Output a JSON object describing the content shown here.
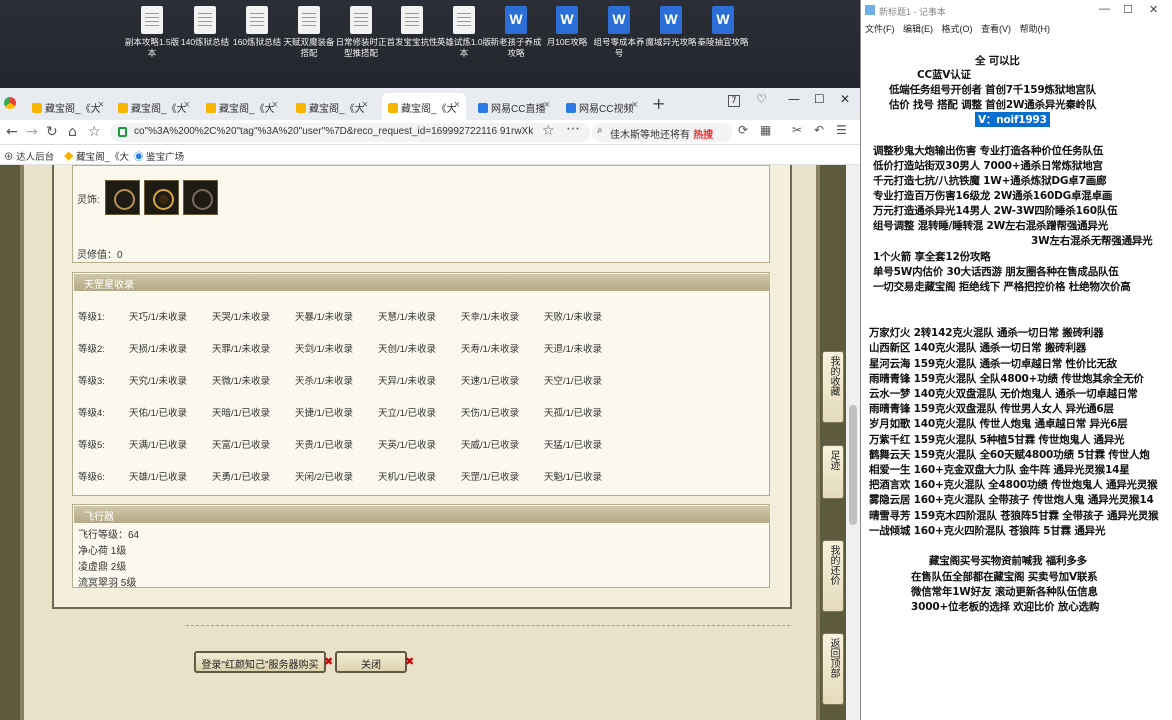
{
  "desktop": {
    "icons": [
      {
        "label": "副本攻略1.5版本",
        "type": "doc"
      },
      {
        "label": "140炼狱总结",
        "type": "doc"
      },
      {
        "label": "160炼狱总结",
        "type": "doc"
      },
      {
        "label": "天赋双魔装备搭配",
        "type": "doc"
      },
      {
        "label": "日常修装时正型推搭配",
        "type": "doc"
      },
      {
        "label": "首发宝宝抗性",
        "type": "doc"
      },
      {
        "label": "英雄试炼1.0版本",
        "type": "doc"
      },
      {
        "label": "新老孩子养成攻略",
        "type": "word"
      },
      {
        "label": "月10E攻略",
        "type": "word"
      },
      {
        "label": "组号零成本养号",
        "type": "word"
      },
      {
        "label": "魔域异光攻略",
        "type": "word"
      },
      {
        "label": "秦陵抽宜攻略",
        "type": "word"
      }
    ]
  },
  "browser": {
    "tabs": [
      {
        "label": "藏宝阁_《大",
        "icon": "treasure-icon"
      },
      {
        "label": "藏宝阁_《大",
        "icon": "treasure-icon"
      },
      {
        "label": "藏宝阁_《大",
        "icon": "treasure-icon"
      },
      {
        "label": "藏宝阁_《大",
        "icon": "treasure-icon"
      },
      {
        "label": "藏宝阁_《大",
        "icon": "treasure-icon"
      },
      {
        "label": "网易CC直播",
        "icon": "cc-icon"
      },
      {
        "label": "网易CC视频",
        "icon": "cc-icon"
      }
    ],
    "tab_badge": "7",
    "url": "co\"%3A%200%2C%20\"tag\"%3A%20\"user\"%7D&reco_request_id=169992722116 91rwXk",
    "search_placeholder": "佳木斯等地还将有",
    "search_hot": "热搜",
    "bookmarks": [
      "达人后台",
      "藏宝阁_《大",
      "鉴宝广场"
    ]
  },
  "page": {
    "gems_label": "灵饰:",
    "spirit_value_label": "灵修值：",
    "spirit_value": "0",
    "stars_header": "天罡星收录",
    "star_rows": [
      {
        "level": "等级1:",
        "items": [
          "天巧/1/未收录",
          "天哭/1/未收录",
          "天暴/1/未收录",
          "天慧/1/未收录",
          "天幸/1/未收录",
          "天败/1/未收录"
        ]
      },
      {
        "level": "等级2:",
        "items": [
          "天损/1/未收录",
          "天罪/1/未收录",
          "天剑/1/未收录",
          "天创/1/未收录",
          "天寿/1/未收录",
          "天退/1/未收录"
        ]
      },
      {
        "level": "等级3:",
        "items": [
          "天究/1/未收录",
          "天微/1/未收录",
          "天杀/1/未收录",
          "天异/1/未收录",
          "天速/1/已收录",
          "天空/1/已收录"
        ]
      },
      {
        "level": "等级4:",
        "items": [
          "天佑/1/已收录",
          "天暗/1/已收录",
          "天捷/1/已收录",
          "天立/1/已收录",
          "天伤/1/已收录",
          "天孤/1/已收录"
        ]
      },
      {
        "level": "等级5:",
        "items": [
          "天满/1/已收录",
          "天富/1/已收录",
          "天贵/1/已收录",
          "天英/1/已收录",
          "天威/1/已收录",
          "天猛/1/已收录"
        ]
      },
      {
        "level": "等级6:",
        "items": [
          "天雄/1/已收录",
          "天勇/1/已收录",
          "天闲/2/已收录",
          "天机/1/已收录",
          "天罡/1/已收录",
          "天魁/1/已收录"
        ]
      }
    ],
    "flight_header": "飞行器",
    "flight_rows": [
      "飞行等级：64",
      "净心荷   1级",
      "凌虚鼎   2级",
      "流冥翠羽   5级"
    ],
    "login_button": "登录\"红颜知己\"服务器购买",
    "close_button": "关闭",
    "side_buttons": [
      "我的收藏",
      "足迹",
      "我的还价",
      "返回顶部"
    ]
  },
  "notepad": {
    "title": "新标题1 - 记事本",
    "menu": [
      "文件(F)",
      "编辑(E)",
      "格式(O)",
      "查看(V)",
      "帮助(H)"
    ],
    "lines": [
      "全   可以比   ",
      "CC蓝V认证        ",
      "低端任务组号开创者          首创7千159炼狱地宫队",
      "估价 找号 搭配 调整          首创2W通杀异光秦岭队",
      "V：noif1993",
      "调整秒鬼大炮输出伤害          专业打造各种价位任务队伍",
      "低价打造站街双30男人          7000+通杀日常炼狱地宫",
      "千元打造七抗/八抗铁魔          1W+通杀炼狱DG卓7画廊",
      "专业打造百万伤害16级龙          2W通杀160DG卓混卓画",
      "万元打造通杀异光14男人          2W-3W四阶睡杀160队伍",
      "组号调整 混转睡/睡转混          2W左右混杀蹭帮强通异光",
      "3W左右混杀无帮强通异光",
      "1个火箭 享全套12份攻略",
      "单号5W内估价 30大话西游          朋友圈各种在售成品队伍",
      "一切交易走藏宝阁 拒绝线下     严格把控价格 杜绝物次价高",
      "万家灯火 2转142克火混队 通杀一切日常 搬砖利器",
      "山西新区 140克火混队 通杀一切日常 搬砖利器",
      "星河云海 159克火混队 通杀一切卓越日常 性价比无敌",
      "雨晴青锋 159克火混队 全队4800+功绩 传世炮其余全无价",
      "云水一梦 140克火双盘混队 无价炮鬼人 通杀一切卓越日常",
      "雨晴青锋 159克火双盘混队 传世男人女人 异光通6层",
      "岁月如歌 140克火混队 传世人炮鬼 通卓越日常 异光6层",
      "万紫千红 159克火混队 5种植5甘霖 传世炮鬼人 通异光",
      "鹤舞云天 159克火混队 全60天赋4800功绩 5甘霖 传世人炮",
      "相爱一生 160+克金双盘大力队 金牛阵 通异光灵猴14星",
      "把酒言欢 160+克火混队 全4800功绩 传世炮鬼人 通异光灵猴",
      "雾隐云居 160+克火混队 全带孩子 传世炮人鬼 通异光灵猴14",
      "晴雪寻芳 159克木四阶混队 苍狼阵5甘霖 全带孩子 通异光灵猴",
      "一战倾城 160+克火四阶混队 苍狼阵 5甘霖 通异光",
      "藏宝阁买号买物资前喊我 福利多多",
      "在售队伍全部都在藏宝阁 买卖号加V联系",
      "微信常年1W好友 滚动更新各种队伍信息",
      "3000+位老板的选择 欢迎比价 放心选购"
    ]
  },
  "colors": {
    "selection": "#0a6ed1",
    "page_bg": "#f4efdc",
    "section_header": "#b3aa88"
  }
}
